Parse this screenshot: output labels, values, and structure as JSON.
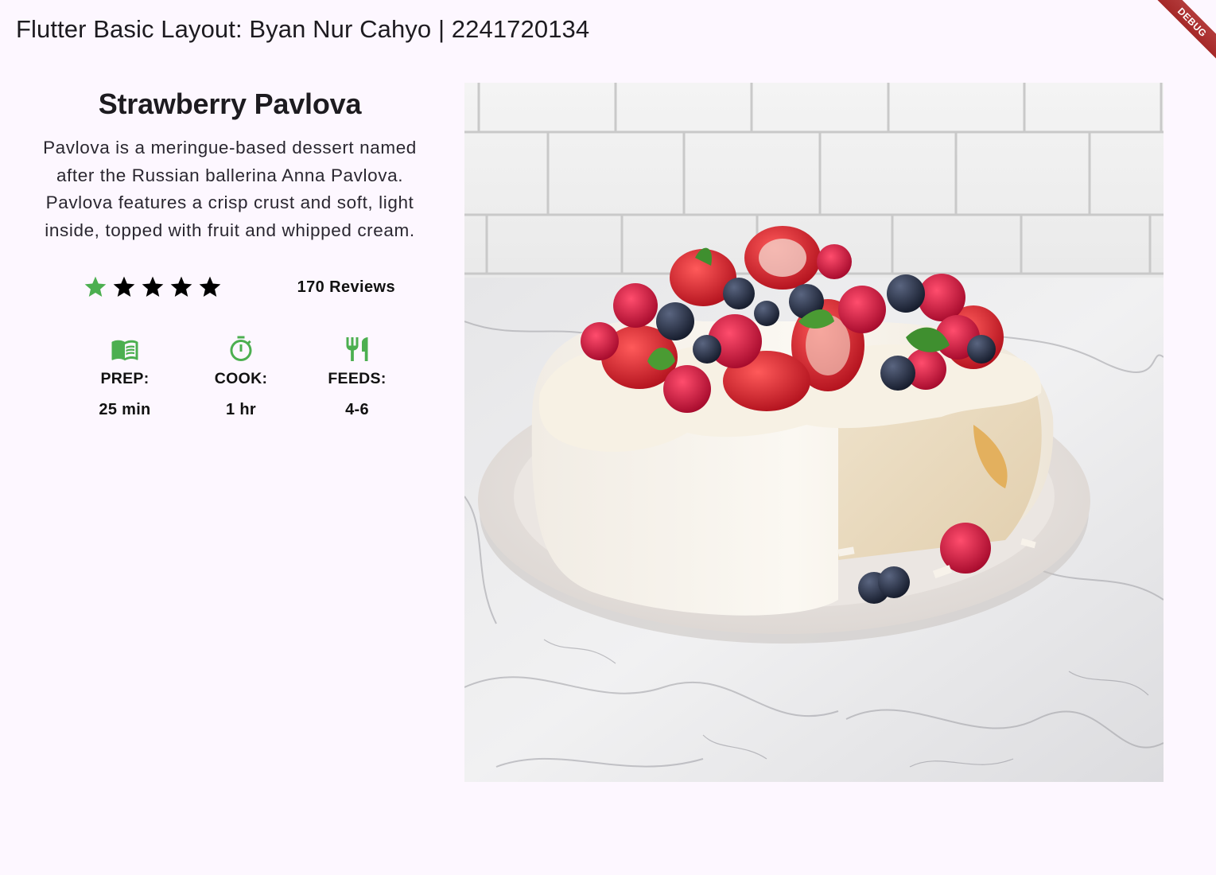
{
  "app_bar": {
    "title": "Flutter Basic Layout: Byan Nur Cahyo | 2241720134",
    "debug_label": "DEBUG"
  },
  "recipe": {
    "title": "Strawberry Pavlova",
    "description": "Pavlova is a meringue-based dessert named after the Russian ballerina Anna Pavlova. Pavlova features a crisp crust and soft, light inside, topped with fruit and whipped cream.",
    "rating": {
      "stars_total": 5,
      "stars_green": 1,
      "reviews_label": "170 Reviews"
    },
    "info": [
      {
        "icon": "book-icon",
        "label": "PREP:",
        "value": "25 min"
      },
      {
        "icon": "timer-icon",
        "label": "COOK:",
        "value": "1 hr"
      },
      {
        "icon": "restaurant-icon",
        "label": "FEEDS:",
        "value": "4-6"
      }
    ]
  },
  "colors": {
    "background": "#fdf7ff",
    "icon_green": "#4caf50",
    "star_black": "#000000",
    "debug_red": "#b3261e"
  },
  "image": {
    "subject": "strawberry pavlova with berries on a plate",
    "icon": "pavlova-photo"
  }
}
